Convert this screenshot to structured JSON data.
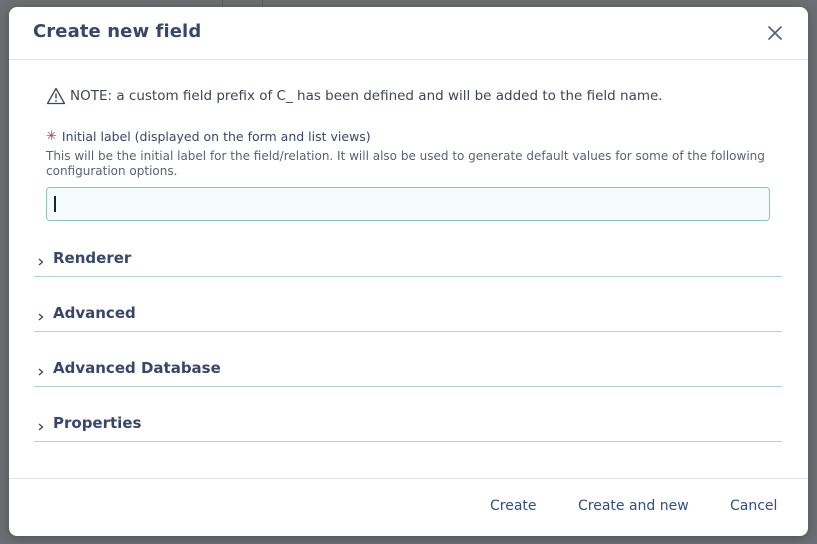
{
  "modal": {
    "title": "Create new field",
    "note": "NOTE: a custom field prefix of C_ has been defined and will be added to the field name.",
    "label_field": {
      "label": "Initial label (displayed on the form and list views)",
      "help": "This will be the initial label for the field/relation. It will also be used to generate default values for some of the following configuration options.",
      "value": "",
      "placeholder": ""
    },
    "sections": [
      {
        "label": "Renderer"
      },
      {
        "label": "Advanced"
      },
      {
        "label": "Advanced Database"
      },
      {
        "label": "Properties"
      }
    ],
    "footer": {
      "create_label": "Create",
      "create_and_new_label": "Create and new",
      "cancel_label": "Cancel"
    }
  },
  "icons": {
    "close": "close-icon",
    "warning": "warning-icon",
    "required": "asterisk-icon",
    "expand": "chevron-right-icon"
  },
  "colors": {
    "title": "#37476b",
    "link": "#2e4f8a",
    "required": "#b0383c",
    "input_border": "#8dc3c6",
    "section_divider": "#a9d4d6",
    "overlay": "#6b6e72"
  }
}
